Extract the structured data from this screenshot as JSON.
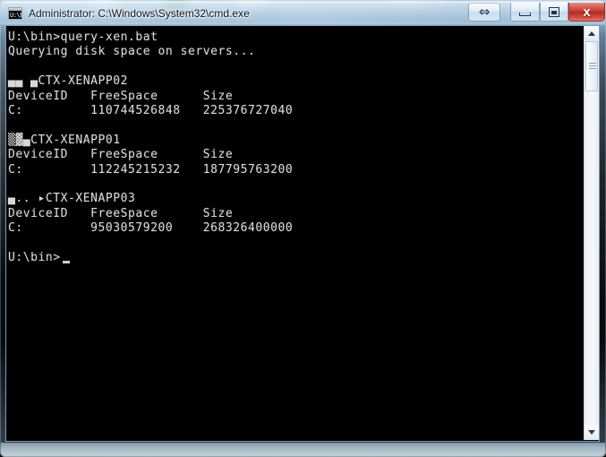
{
  "window": {
    "title": "Administrator: C:\\Windows\\System32\\cmd.exe",
    "icon": "cmd-console-icon",
    "icon_prompt": "c:\\",
    "buttons": {
      "resize_label": "⇔",
      "resize_name": "restore-size-arrows-icon",
      "minimize_label": "",
      "maximize_label": "",
      "close_label": "x"
    },
    "accent_close_color": "#c2372c",
    "frame_color": "#7e9cb8"
  },
  "console": {
    "background_color": "#000000",
    "foreground_color": "#d8d8d8",
    "prompt": "U:\\bin>",
    "command": "query-xen.bat",
    "status_line": "Querying disk space on servers...",
    "columns": [
      "DeviceID",
      "FreeSpace",
      "Size"
    ],
    "servers": [
      {
        "prefix_glyphs": "▄▄ ▄",
        "name": "CTX-XENAPP02",
        "rows": [
          {
            "device_id": "C:",
            "free_space": "110744526848",
            "size": "225376727040"
          }
        ]
      },
      {
        "prefix_glyphs": "▒▓▄",
        "name": "CTX-XENAPP01",
        "rows": [
          {
            "device_id": "C:",
            "free_space": "112245215232",
            "size": "187795763200"
          }
        ]
      },
      {
        "prefix_glyphs": "▄.. ▸",
        "name": "CTX-XENAPP03",
        "rows": [
          {
            "device_id": "C:",
            "free_space": "95030579200",
            "size": "268326400000"
          }
        ]
      }
    ],
    "final_prompt": "U:\\bin>",
    "cursor": "_",
    "full_text": "U:\\bin>query-xen.bat\nQuerying disk space on servers...\n\n▄▄ ▄CTX-XENAPP02\nDeviceID   FreeSpace      Size\nC:         110744526848   225376727040\n\n▒▓▄CTX-XENAPP01\nDeviceID   FreeSpace      Size\nC:         112245215232   187795763200\n\n▄.. ▸CTX-XENAPP03\nDeviceID   FreeSpace      Size\nC:         95030579200    268326400000\n\nU:\\bin>"
  },
  "scrollbar": {
    "up_arrow": "scroll-up-arrow-icon",
    "down_arrow": "scroll-down-arrow-icon",
    "thumb_position_percent": 4
  }
}
